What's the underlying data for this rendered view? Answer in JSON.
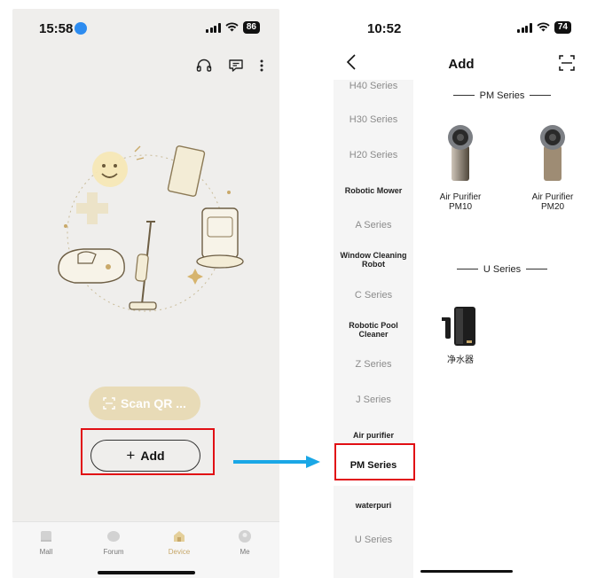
{
  "left": {
    "status": {
      "time": "15:58",
      "battery": "86"
    },
    "toolbar": {
      "support_icon": "headset-icon",
      "message_icon": "message-icon",
      "more_icon": "more-vertical-icon"
    },
    "scan_button": {
      "label": "Scan QR ...",
      "icon": "scan-icon"
    },
    "add_button": {
      "label": "Add",
      "icon": "plus-icon"
    },
    "tabs": [
      {
        "label": "Mall",
        "icon": "mall-icon"
      },
      {
        "label": "Forum",
        "icon": "forum-icon"
      },
      {
        "label": "Device",
        "icon": "home-icon",
        "active": true
      },
      {
        "label": "Me",
        "icon": "profile-icon"
      }
    ],
    "colors": {
      "accent": "#c7a86a",
      "scan_bg": "#e8dbb7",
      "screen_bg": "#efeeec"
    }
  },
  "right": {
    "status": {
      "time": "10:52",
      "battery": "74"
    },
    "nav": {
      "title": "Add",
      "back_icon": "back-chevron-icon",
      "scan_icon": "scan-icon"
    },
    "categories": [
      {
        "label": "H40 Series"
      },
      {
        "label": "H30 Series"
      },
      {
        "label": "H20 Series"
      },
      {
        "label": "Robotic Mower"
      },
      {
        "label": "A Series"
      },
      {
        "label": "Window Cleaning Robot"
      },
      {
        "label": "C Series"
      },
      {
        "label": "Robotic Pool Cleaner"
      },
      {
        "label": "Z Series"
      },
      {
        "label": "J Series"
      },
      {
        "label": "Air purifier"
      },
      {
        "label": "PM Series",
        "selected": true
      },
      {
        "label": "waterpuri"
      },
      {
        "label": "U Series"
      }
    ],
    "sections": [
      {
        "title": "PM Series",
        "products": [
          {
            "name": "Air Purifier PM10"
          },
          {
            "name": "Air Purifier PM20"
          }
        ]
      },
      {
        "title": "U Series",
        "products": [
          {
            "name": "净水器"
          }
        ]
      }
    ]
  },
  "annotation": {
    "highlight_color": "#e10f14",
    "arrow_color": "#1aa7e6"
  }
}
